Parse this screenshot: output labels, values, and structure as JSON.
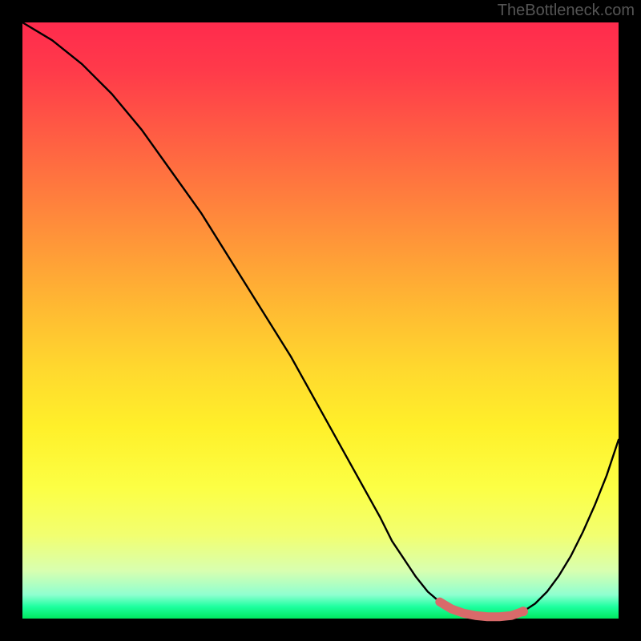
{
  "watermark": "TheBottleneck.com",
  "chart_data": {
    "type": "line",
    "title": "",
    "xlabel": "",
    "ylabel": "",
    "xlim": [
      0,
      100
    ],
    "ylim": [
      0,
      100
    ],
    "series": [
      {
        "name": "main-curve",
        "x": [
          0,
          5,
          10,
          15,
          20,
          25,
          30,
          35,
          40,
          45,
          50,
          55,
          60,
          62,
          64,
          66,
          68,
          70,
          72,
          74,
          76,
          78,
          80,
          82,
          84,
          86,
          88,
          90,
          92,
          94,
          96,
          98,
          100
        ],
        "y": [
          100,
          97,
          93,
          88,
          82,
          75,
          68,
          60,
          52,
          44,
          35,
          26,
          17,
          13,
          10,
          7,
          4.5,
          2.8,
          1.6,
          0.9,
          0.5,
          0.3,
          0.3,
          0.5,
          1.2,
          2.5,
          4.5,
          7.2,
          10.5,
          14.5,
          19,
          24,
          30
        ]
      },
      {
        "name": "highlight-segment",
        "x": [
          70,
          72,
          74,
          76,
          78,
          80,
          82,
          84
        ],
        "y": [
          2.8,
          1.6,
          0.9,
          0.5,
          0.3,
          0.3,
          0.5,
          1.2
        ]
      }
    ],
    "gradient_colors": {
      "top": "#ff2b4d",
      "mid": "#ffd82e",
      "bottom": "#00e860"
    },
    "highlight_color": "#d96a6a"
  }
}
